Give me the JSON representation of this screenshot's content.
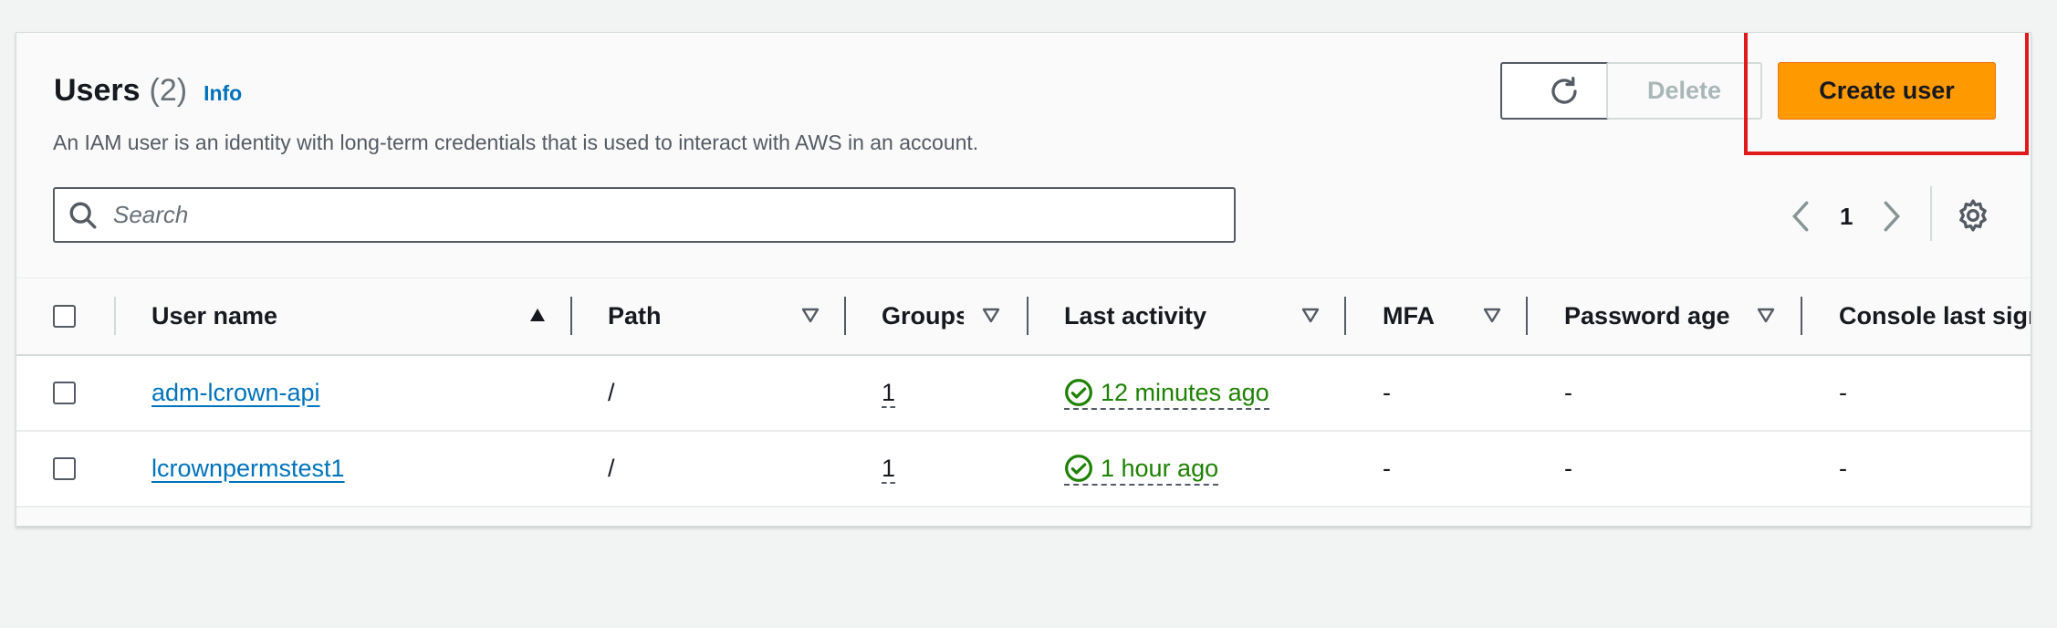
{
  "header": {
    "title": "Users",
    "count": "(2)",
    "info_link": "Info",
    "description": "An IAM user is an identity with long-term credentials that is used to interact with AWS in an account."
  },
  "toolbar": {
    "refresh_icon": "refresh-icon",
    "delete_label": "Delete",
    "create_label": "Create user",
    "create_color": "#ff9900"
  },
  "search": {
    "placeholder": "Search"
  },
  "pagination": {
    "page": "1"
  },
  "table": {
    "columns": [
      "User name",
      "Path",
      "Groups",
      "Last activity",
      "MFA",
      "Password age",
      "Console last sign-in"
    ],
    "column_headers_visible": [
      "User name",
      "Path",
      "Groups",
      "Last activity",
      "MFA",
      "Password age",
      "Console last sign"
    ],
    "sort": {
      "column": "User name",
      "direction": "ascending"
    },
    "rows": [
      {
        "user_name": "adm-lcrown-api",
        "path": "/",
        "groups": "1",
        "last_activity": "12 minutes ago",
        "mfa": "-",
        "password_age": "-",
        "console_last_signin": "-"
      },
      {
        "user_name": "lcrownpermstest1",
        "path": "/",
        "groups": "1",
        "last_activity": "1 hour ago",
        "mfa": "-",
        "password_age": "-",
        "console_last_signin": "-"
      }
    ]
  },
  "colors": {
    "link": "#0073bb",
    "success": "#1d8102",
    "highlight": "#e01b1b"
  }
}
